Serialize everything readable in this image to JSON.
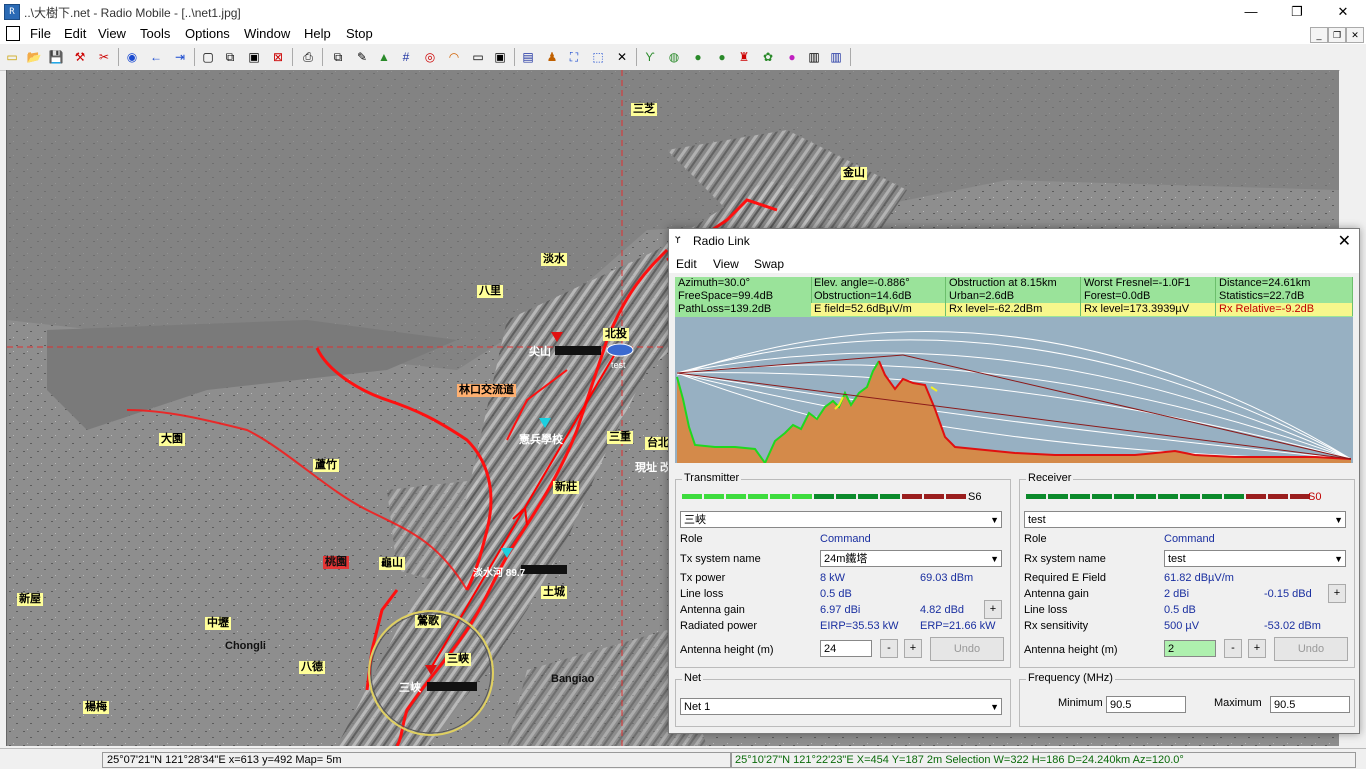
{
  "window": {
    "title": "..\\大樹下.net - Radio Mobile - [..\\net1.jpg]",
    "minimize": "—",
    "restore": "❐",
    "close": "✕"
  },
  "menubar": {
    "items": [
      "File",
      "Edit",
      "View",
      "Tools",
      "Options",
      "Window",
      "Help",
      "Stop"
    ]
  },
  "map": {
    "places": [
      "三芝",
      "金山",
      "淡水",
      "八里",
      "尖山",
      "北投",
      "林口交流道",
      "憲兵學校",
      "大園",
      "蘆竹",
      "三重",
      "新莊",
      "桃園",
      "龜山",
      "淡水河 89.7",
      "新屋",
      "中壢",
      "Chongli",
      "八德",
      "土城",
      "鶯歌",
      "三峽",
      "Bangiao",
      "楊梅",
      "台北",
      "現址 改",
      "test",
      "三峽"
    ]
  },
  "statusbar": {
    "left": "25°07'21\"N  121°28'34\"E    x=613 y=492 Map= 5m",
    "right": "25°10'27\"N 121°22'23\"E  X=454 Y=187 2m Selection W=322 H=186 D=24.240km Az=120.0°"
  },
  "radio_link": {
    "title": "Radio Link",
    "menu": [
      "Edit",
      "View",
      "Swap"
    ],
    "stats": {
      "azimuth": "Azimuth=30.0°",
      "elev": "Elev. angle=-0.886°",
      "obstruction_at": "Obstruction at 8.15km",
      "worst_fresnel": "Worst Fresnel=-1.0F1",
      "distance": "Distance=24.61km",
      "freespace": "FreeSpace=99.4dB",
      "obstruction": "Obstruction=14.6dB",
      "urban": "Urban=2.6dB",
      "forest": "Forest=0.0dB",
      "statistics": "Statistics=22.7dB",
      "pathloss": "PathLoss=139.2dB",
      "efield": "E field=52.6dBµV/m",
      "rxlevel_db": "Rx level=-62.2dBm",
      "rxlevel_uv": "Rx level=173.3939µV",
      "rx_relative": "Rx Relative=-9.2dB"
    },
    "transmitter": {
      "group": "Transmitter",
      "s_value": "S6",
      "unit": "三峽",
      "role_label": "Role",
      "role_value": "Command",
      "system_label": "Tx system name",
      "system_value": "24m鐵塔",
      "power_label": "Tx power",
      "power_kw": "8 kW",
      "power_dbm": "69.03 dBm",
      "lineloss_label": "Line loss",
      "lineloss_value": "0.5 dB",
      "gain_label": "Antenna gain",
      "gain_dbi": "6.97 dBi",
      "gain_dbd": "4.82 dBd",
      "radiated_label": "Radiated power",
      "eirp": "EIRP=35.53 kW",
      "erp": "ERP=21.66 kW",
      "height_label": "Antenna height (m)",
      "height_value": "24",
      "undo": "Undo"
    },
    "receiver": {
      "group": "Receiver",
      "s_value": "S0",
      "unit": "test",
      "role_label": "Role",
      "role_value": "Command",
      "system_label": "Rx system name",
      "system_value": "test",
      "field_label": "Required E Field",
      "field_value": "61.82 dBµV/m",
      "gain_label": "Antenna gain",
      "gain_dbi": "2 dBi",
      "gain_dbd": "-0.15 dBd",
      "lineloss_label": "Line loss",
      "lineloss_value": "0.5 dB",
      "sens_label": "Rx sensitivity",
      "sens_uv": "500 µV",
      "sens_dbm": "-53.02 dBm",
      "height_label": "Antenna height (m)",
      "height_value": "2",
      "undo": "Undo"
    },
    "net": {
      "group": "Net",
      "value": "Net  1"
    },
    "frequency": {
      "group": "Frequency (MHz)",
      "min_label": "Minimum",
      "min_value": "90.5",
      "max_label": "Maximum",
      "max_value": "90.5"
    },
    "colors": {
      "stats_green": "#9ae39a",
      "stats_yellow": "#f7f78c",
      "profile_sky": "#97b0c2",
      "terrain": "#d48a4a",
      "meter_green": "#3ddc3d",
      "meter_dark": "#0b8a2b",
      "meter_red": "#9a1e1e"
    }
  }
}
